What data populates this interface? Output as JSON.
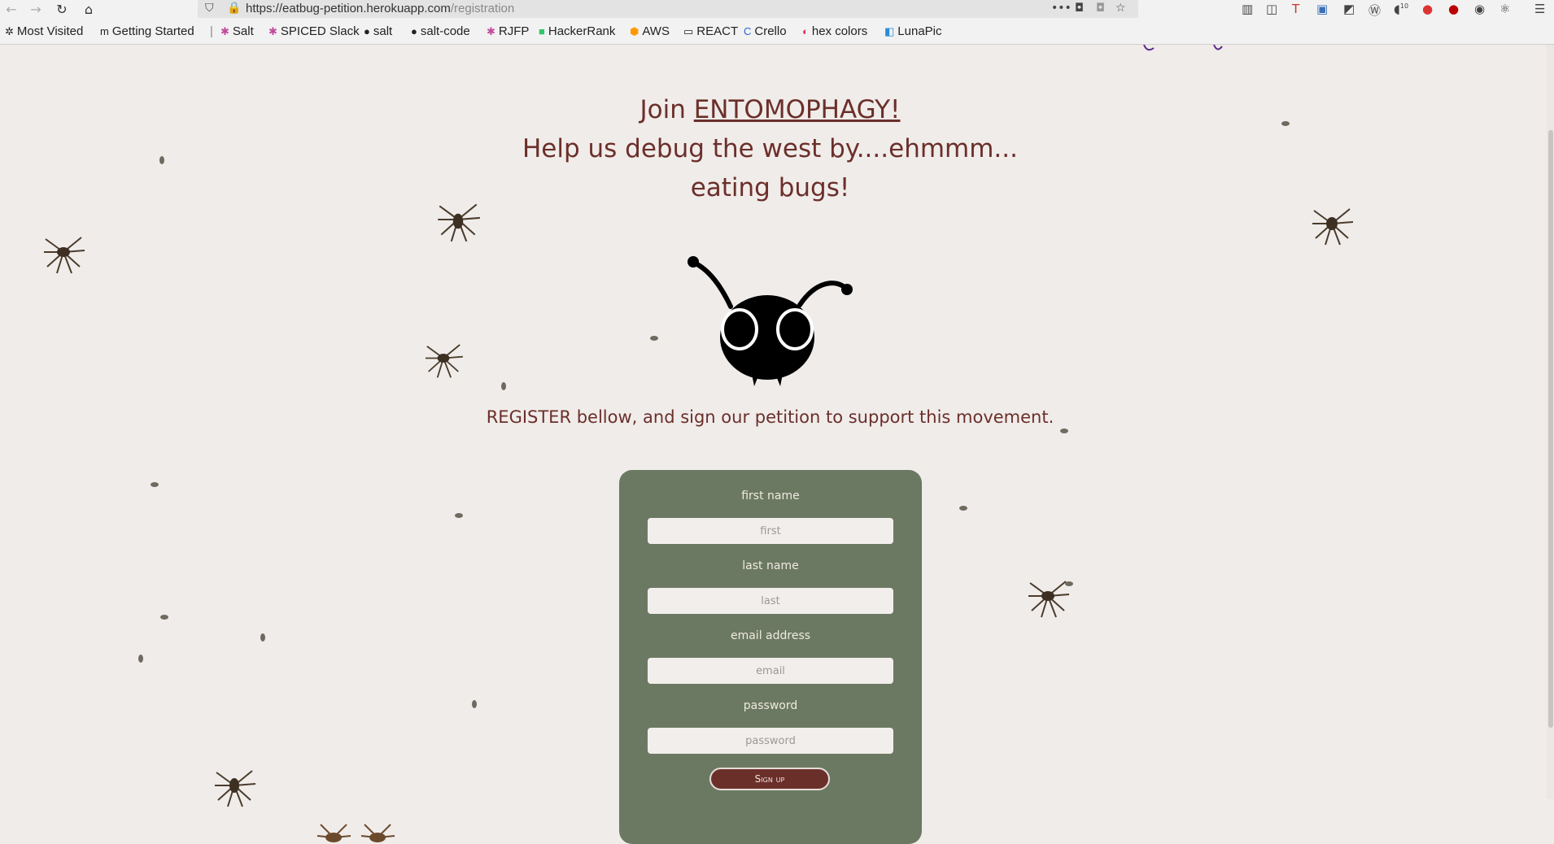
{
  "browser": {
    "url_base": "https://eatbug-petition.herokuapp.com",
    "url_path": "/registration",
    "bookmarks": [
      {
        "label": "Most Visited",
        "icon": "gear-icon"
      },
      {
        "label": "Getting Started",
        "icon": "m-icon"
      },
      {
        "label": "Salt",
        "icon": "slack-icon"
      },
      {
        "label": "SPICED Slack",
        "icon": "slack-icon"
      },
      {
        "label": "salt",
        "icon": "github-icon"
      },
      {
        "label": "salt-code",
        "icon": "github-icon"
      },
      {
        "label": "RJFP",
        "icon": "slack-icon"
      },
      {
        "label": "HackerRank",
        "icon": "hackerrank-icon"
      },
      {
        "label": "AWS",
        "icon": "aws-icon"
      },
      {
        "label": "REACT",
        "icon": "folder-icon"
      },
      {
        "label": "Crello",
        "icon": "crello-icon"
      },
      {
        "label": "hex colors",
        "icon": "hex-icon"
      },
      {
        "label": "LunaPic",
        "icon": "lunapic-icon"
      }
    ],
    "notification_count": "10"
  },
  "page": {
    "heading_prefix": "Join ",
    "heading_brand": "ENTOMOPHAGY!",
    "heading_line2": "Help us debug the west by....ehmmm...",
    "heading_line3": "eating bugs!",
    "subtitle": "REGISTER bellow, and sign our petition to support this movement."
  },
  "form": {
    "first_label": "first name",
    "first_placeholder": "first",
    "last_label": "last name",
    "last_placeholder": "last",
    "email_label": "email address",
    "email_placeholder": "email",
    "password_label": "password",
    "password_placeholder": "password",
    "signup_label": "Sign up"
  },
  "colors": {
    "background": "#f0ecea",
    "text": "#6b2f2a",
    "card": "#6c7962",
    "button": "#6b2f2a"
  }
}
